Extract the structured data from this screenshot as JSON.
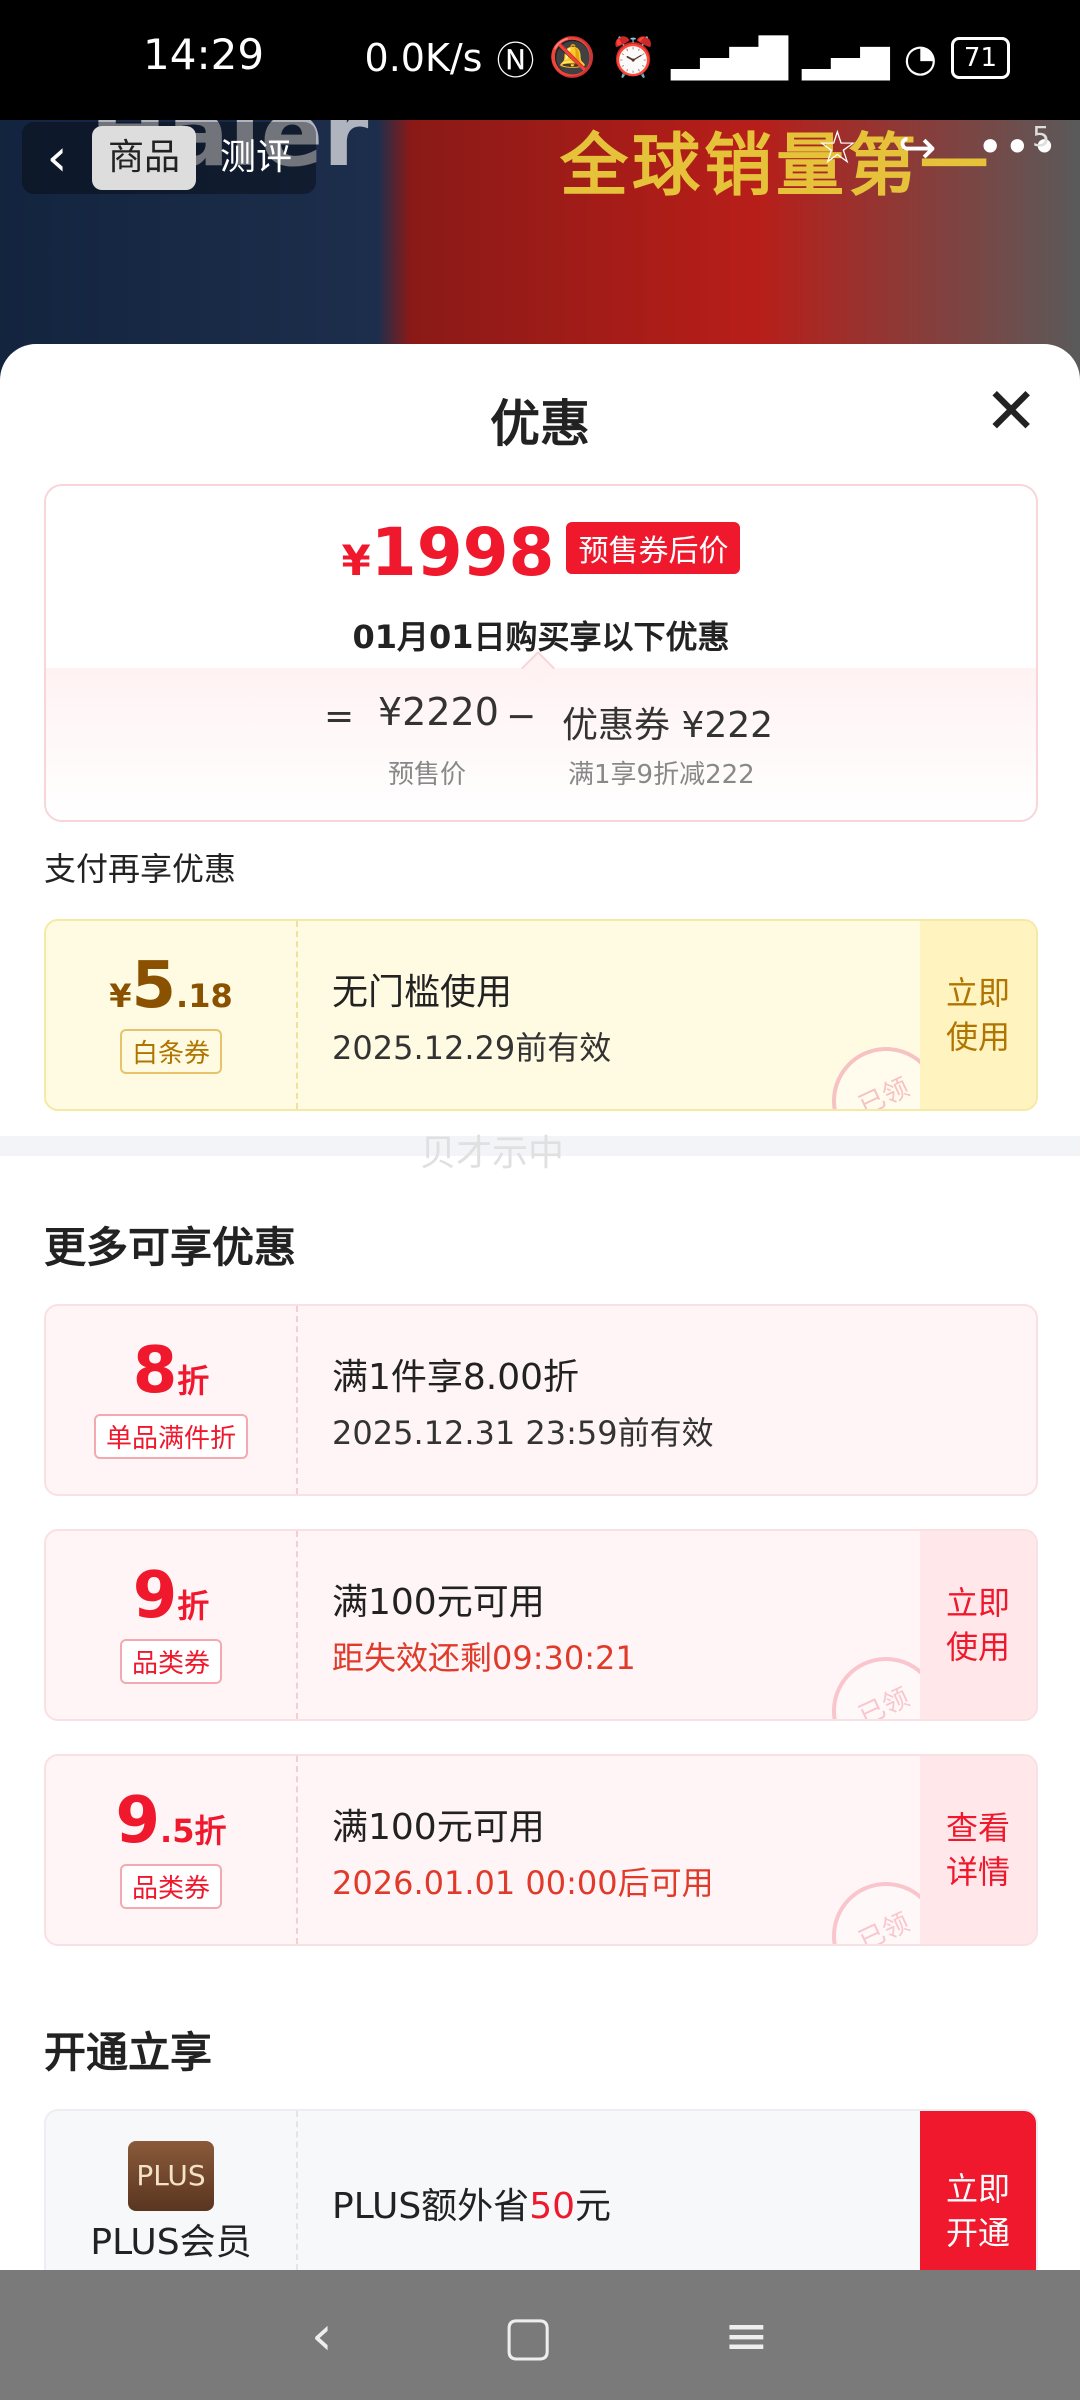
{
  "status": {
    "time": "14:29",
    "net": "0.0K/s",
    "battery": "71"
  },
  "hero": {
    "banner": "全球销量第一",
    "logo": "Haier",
    "badge": "5"
  },
  "top_nav": {
    "tabs": [
      "商品",
      "测评"
    ]
  },
  "sheet": {
    "title": "优惠"
  },
  "price_card": {
    "symbol": "¥",
    "final_price": "1998",
    "tag": "预售券后价",
    "subtitle": "01月01日购买享以下优惠",
    "eq": "=",
    "presale_price": "¥2220",
    "presale_label": "预售价",
    "minus": "−",
    "coupon_label": "优惠券 ¥222",
    "coupon_rule": "满1享9折减222"
  },
  "pay_section": {
    "title": "支付再享优惠"
  },
  "watermark": "贝才示中",
  "coupons": [
    {
      "symbol": "¥",
      "value": "5",
      "small": ".18",
      "type": "白条券",
      "headline": "无门槛使用",
      "detail": "2025.12.29前有效",
      "action": "立即\n使用",
      "stamp": "已领"
    },
    {
      "value": "8",
      "small": "折",
      "type": "单品满件折",
      "headline": "满1件享8.00折",
      "detail": "2025.12.31 23:59前有效"
    },
    {
      "value": "9",
      "small": "折",
      "type": "品类券",
      "headline": "满100元可用",
      "detail": "距失效还剩09:30:21",
      "action": "立即\n使用",
      "stamp": "已领"
    },
    {
      "value": "9",
      "small": ".5折",
      "type": "品类券",
      "headline": "满100元可用",
      "detail": "2026.01.01 00:00后可用",
      "action": "查看\n详情",
      "stamp": "已领"
    }
  ],
  "more_section": {
    "title": "更多可享优惠"
  },
  "open_section": {
    "title": "开通立享"
  },
  "plus": {
    "logo": "PLUS",
    "name": "PLUS会员",
    "text_pre": "PLUS额外省",
    "amount": "50",
    "text_post": "元",
    "action": "立即\n开通"
  }
}
